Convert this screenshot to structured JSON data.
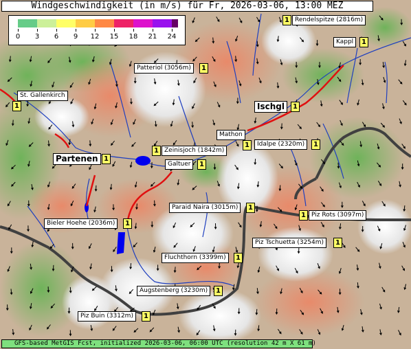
{
  "title": "Windgeschwindigkeit (in m/s) für Fr, 2026-03-06, 13:00 MEZ",
  "legend": {
    "ticks": [
      "0",
      "3",
      "6",
      "9",
      "12",
      "15",
      "18",
      "21",
      "24"
    ],
    "colors": [
      "#66cc88",
      "#ccf099",
      "#ffff66",
      "#ffcc44",
      "#ff8844",
      "#ee2266",
      "#dd11cc",
      "#9911ee",
      "#660066"
    ]
  },
  "places": [
    {
      "name": "Rendelspitze (2816m)",
      "badge": "1"
    },
    {
      "name": "Kappl",
      "badge": "1"
    },
    {
      "name": "Patteriol (3056m)",
      "badge": "1"
    },
    {
      "name": "St. Gallenkirch",
      "badge": "1"
    },
    {
      "name": "Ischgl",
      "badge": "1"
    },
    {
      "name": "Mathon",
      "badge": "1"
    },
    {
      "name": "Idalpe (2320m)",
      "badge": "1"
    },
    {
      "name": "Zeinisjoch (1842m)",
      "badge": "1"
    },
    {
      "name": "Partenen",
      "badge": "1"
    },
    {
      "name": "Galtuer",
      "badge": "1"
    },
    {
      "name": "Paraid Naira (3015m)",
      "badge": "1"
    },
    {
      "name": "Piz Rots (3097m)",
      "badge": "1"
    },
    {
      "name": "Bieler Hoehe (2036m)",
      "badge": "1"
    },
    {
      "name": "Piz Tschuetta (3254m)",
      "badge": "1"
    },
    {
      "name": "Fluchthorn (3399m)",
      "badge": "1"
    },
    {
      "name": "Augstenberg (3230m)",
      "badge": "1"
    },
    {
      "name": "Piz Buin (3312m)",
      "badge": "1"
    }
  ],
  "footer": "GFS-based MetGIS Fcst, initialized 2026-03-06, 06:00 UTC  (resolution 42 m X 61 m)"
}
